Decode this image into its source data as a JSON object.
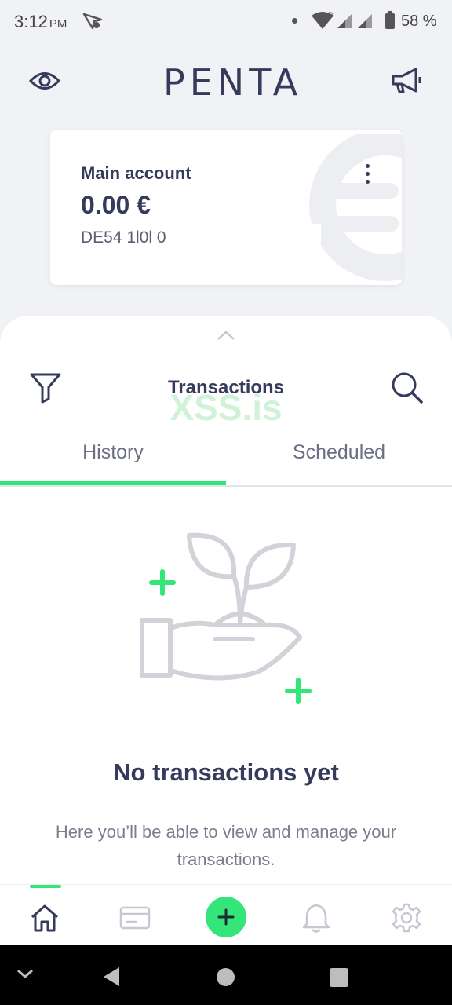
{
  "status_bar": {
    "time": "3:12",
    "ampm": "PM",
    "battery_percent": "58 %"
  },
  "header": {
    "brand": "PENTA"
  },
  "account_card": {
    "title": "Main account",
    "balance": "0.00 €",
    "iban_visible": "DE54 1l0l 0"
  },
  "transactions": {
    "title": "Transactions",
    "watermark": "XSS.is",
    "tabs": [
      {
        "label": "History",
        "active": true
      },
      {
        "label": "Scheduled",
        "active": false
      }
    ],
    "empty_state": {
      "title": "No transactions yet",
      "description": "Here you’ll be able to view and manage your transactions."
    }
  },
  "bottom_nav": {
    "items": [
      {
        "icon": "home-icon",
        "active": true
      },
      {
        "icon": "card-icon",
        "active": false
      },
      {
        "icon": "plus-icon",
        "active": false
      },
      {
        "icon": "bell-icon",
        "active": false
      },
      {
        "icon": "gear-icon",
        "active": false
      }
    ]
  },
  "colors": {
    "accent": "#34e57a",
    "text_dark": "#363b5c",
    "background": "#f1f2f5"
  }
}
